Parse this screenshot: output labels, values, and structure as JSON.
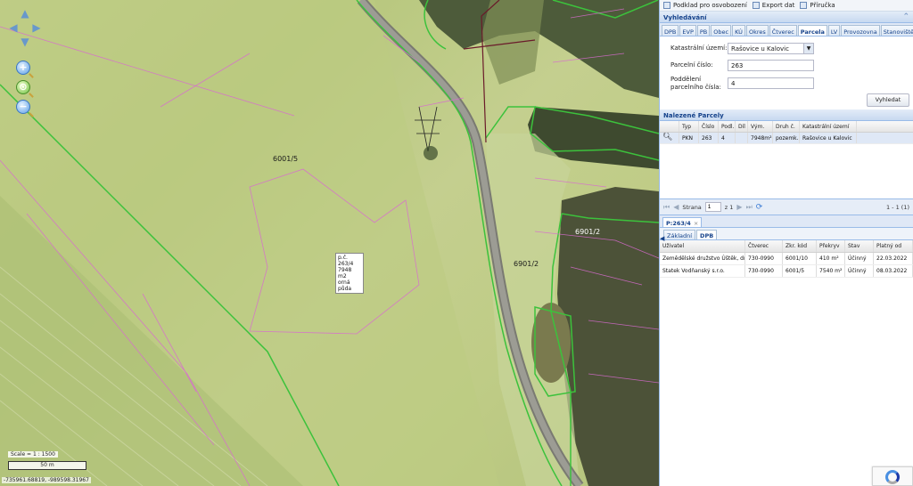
{
  "map": {
    "parcel_labels": [
      "6001/5",
      "6901/2",
      "6901/2"
    ],
    "info_box": [
      "p.č. 263/4",
      "7948 m2",
      "orná půda"
    ],
    "scale_label": "Scale = 1 : 1500",
    "scale_bar_label": "50 m",
    "coords": "-735961.68819, -989598.31967",
    "nav_icons": [
      "arrow-up-icon",
      "arrow-left-icon",
      "arrow-right-icon",
      "arrow-down-icon"
    ],
    "zoom_in": "+",
    "zoom_out": "−"
  },
  "toolbar": {
    "items": [
      "Podklad pro osvobození",
      "Export dat",
      "Příručka"
    ]
  },
  "search": {
    "title": "Vyhledávání",
    "tabs": [
      "DPB",
      "EVP",
      "PB",
      "Obec",
      "KÚ",
      "Okres",
      "Čtverec",
      "Parcela",
      "LV",
      "Provozovna",
      "Stanoviště včel"
    ],
    "active_tab": "Parcela",
    "ku_label": "Katastrální území:",
    "ku_value": "Rašovice u Kalovic",
    "parcel_label": "Parcelní číslo:",
    "parcel_value": "263",
    "subdiv_label_1": "Poddělení",
    "subdiv_label_2": "parcelního čísla:",
    "subdiv_value": "4",
    "search_button": "Vyhledat"
  },
  "results": {
    "title": "Nalezené Parcely",
    "columns": [
      "Typ",
      "Číslo",
      "Podl.",
      "Díl",
      "Vým.",
      "Druh č.",
      "Katastrální území"
    ],
    "row": [
      "PKN",
      "263",
      "4",
      "",
      "7948m²",
      "pozemk...",
      "Rašovice u Kalovic"
    ],
    "pager": {
      "page_label": "Strana",
      "page_value": "1",
      "of_label": "z 1",
      "count": "1 - 1 (1)"
    }
  },
  "detail": {
    "tab_title": "P:263/4",
    "sub_tabs": [
      "Základní",
      "DPB"
    ],
    "active_sub_tab": "DPB",
    "columns": [
      "Uživatel",
      "Čtverec",
      "Zkr. kód",
      "Překryv",
      "Stav",
      "Platný od"
    ],
    "rows": [
      [
        "Zemědělské družstvo Úštěk, dr...",
        "730-0990",
        "6001/10",
        "410 m²",
        "Účinný",
        "22.03.2022"
      ],
      [
        "Statek Vodňanský s.r.o.",
        "730-0990",
        "6001/5",
        "7540 m²",
        "Účinný",
        "08.03.2022"
      ]
    ]
  }
}
